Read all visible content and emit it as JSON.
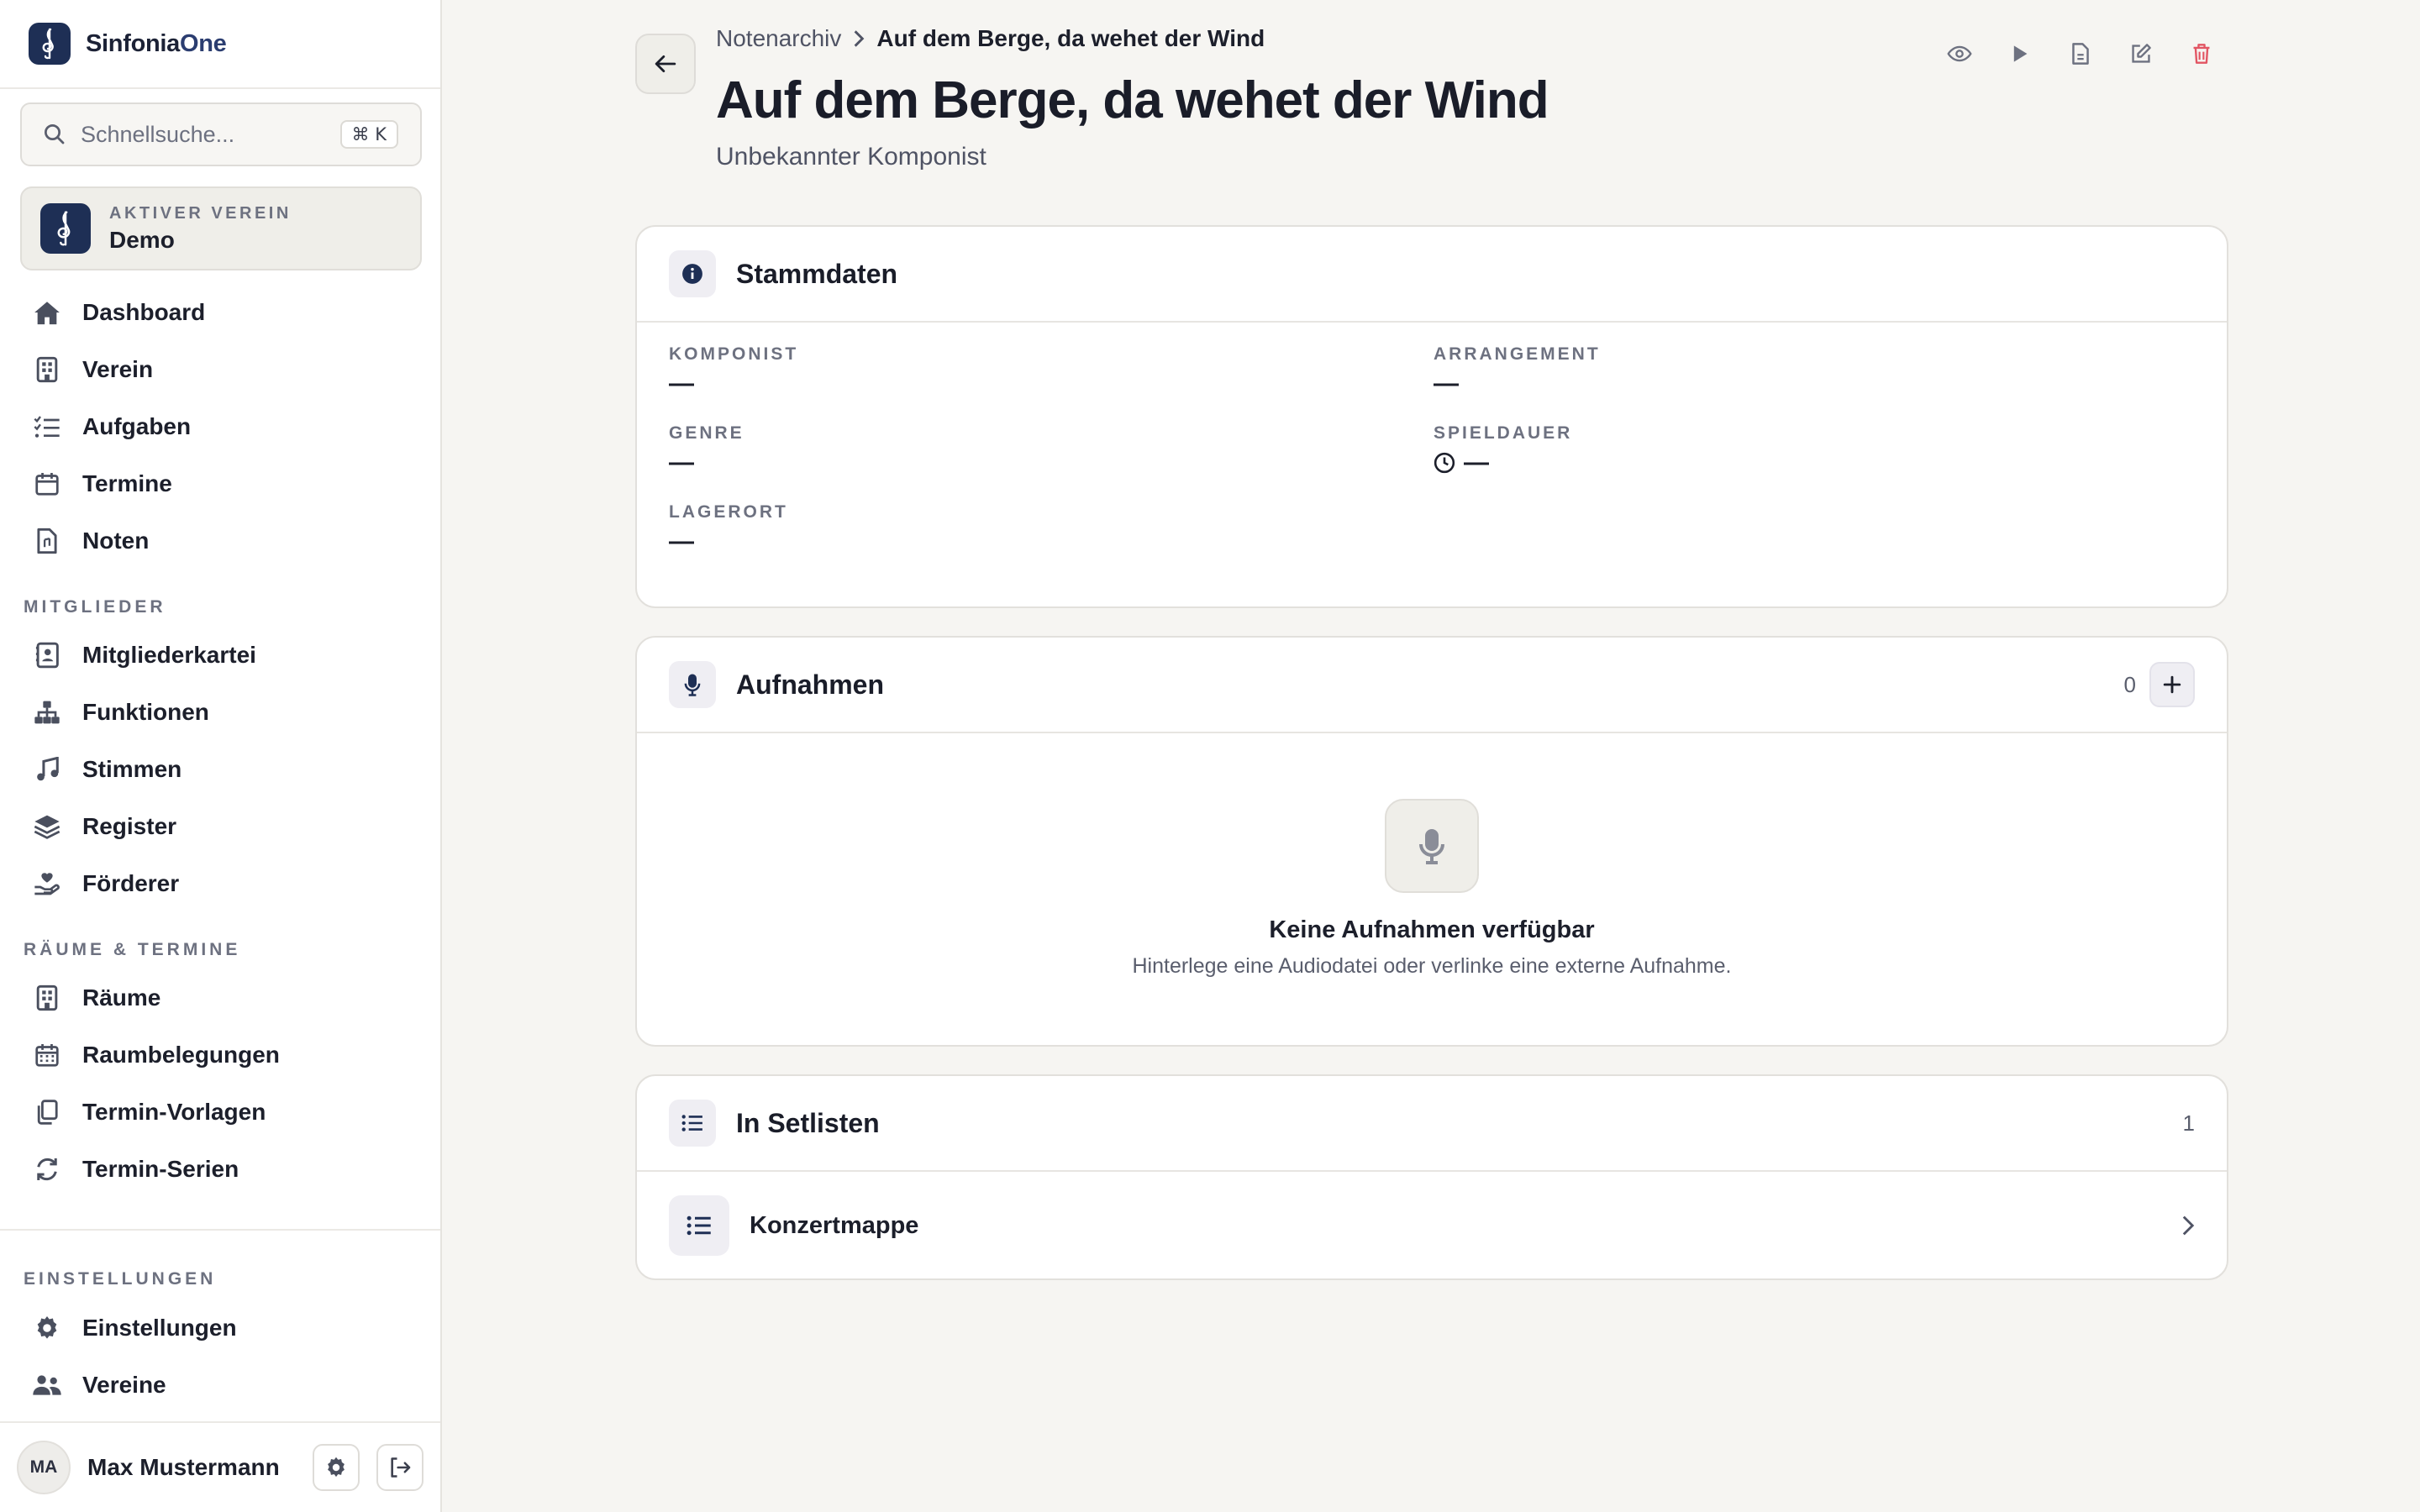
{
  "app": {
    "brand_prefix": "Sinfonia",
    "brand_suffix": "One",
    "logo_icon": "treble-clef-icon"
  },
  "search": {
    "placeholder": "Schnellsuche...",
    "shortcut": "⌘ K"
  },
  "active_club": {
    "caption": "AKTIVER VEREIN",
    "name": "Demo"
  },
  "sidebar": {
    "main_items": [
      {
        "label": "Dashboard",
        "icon": "home-icon"
      },
      {
        "label": "Verein",
        "icon": "building-icon"
      },
      {
        "label": "Aufgaben",
        "icon": "task-list-icon"
      },
      {
        "label": "Termine",
        "icon": "calendar-icon"
      },
      {
        "label": "Noten",
        "icon": "sheet-music-file-icon"
      }
    ],
    "sections": [
      {
        "heading": "MITGLIEDER",
        "items": [
          {
            "label": "Mitgliederkartei",
            "icon": "contact-card-icon"
          },
          {
            "label": "Funktionen",
            "icon": "org-chart-icon"
          },
          {
            "label": "Stimmen",
            "icon": "music-note-icon"
          },
          {
            "label": "Register",
            "icon": "layers-icon"
          },
          {
            "label": "Förderer",
            "icon": "hand-heart-icon"
          }
        ]
      },
      {
        "heading": "RÄUME & TERMINE",
        "items": [
          {
            "label": "Räume",
            "icon": "building-icon"
          },
          {
            "label": "Raumbelegungen",
            "icon": "calendar-grid-icon"
          },
          {
            "label": "Termin-Vorlagen",
            "icon": "copy-icon"
          },
          {
            "label": "Termin-Serien",
            "icon": "refresh-icon"
          }
        ]
      }
    ],
    "settings_heading": "EINSTELLUNGEN",
    "settings_items": [
      {
        "label": "Einstellungen",
        "icon": "gear-icon"
      },
      {
        "label": "Vereine",
        "icon": "users-icon"
      }
    ]
  },
  "user": {
    "initials": "MA",
    "name": "Max Mustermann"
  },
  "breadcrumb": {
    "parent": "Notenarchiv",
    "current": "Auf dem Berge, da wehet der Wind"
  },
  "page": {
    "title": "Auf dem Berge, da wehet der Wind",
    "subtitle": "Unbekannter Komponist"
  },
  "top_actions": [
    "eye-icon",
    "play-icon",
    "file-pdf-icon",
    "edit-icon",
    "trash-icon"
  ],
  "stammdaten": {
    "title": "Stammdaten",
    "fields": [
      {
        "label": "KOMPONIST",
        "value": "—"
      },
      {
        "label": "ARRANGEMENT",
        "value": "—"
      },
      {
        "label": "GENRE",
        "value": "—"
      },
      {
        "label": "SPIELDAUER",
        "value": "—"
      },
      {
        "label": "LAGERORT",
        "value": "—"
      }
    ]
  },
  "aufnahmen": {
    "title": "Aufnahmen",
    "count": "0",
    "empty_title": "Keine Aufnahmen verfügbar",
    "empty_text": "Hinterlege eine Audiodatei oder verlinke eine externe Aufnahme."
  },
  "setlisten": {
    "title": "In Setlisten",
    "count": "1",
    "items": [
      {
        "name": "Konzertmappe"
      }
    ]
  },
  "colors": {
    "brand_navy": "#1e2f55",
    "danger": "#e25563",
    "background": "#f6f5f2"
  }
}
